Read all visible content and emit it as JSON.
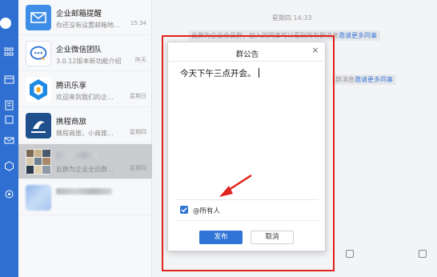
{
  "conversations": [
    {
      "name": "企业邮箱提醒",
      "preview": "你还没有设置邮箱地...",
      "time": "15:34",
      "avatar": "mail-avatar",
      "color": "#3e8ee8"
    },
    {
      "name": "企业微信团队",
      "preview": "3.0.12版本新功能介绍",
      "time": "昨天",
      "avatar": "wecom-team-avatar",
      "color": "#2f74d6"
    },
    {
      "name": "腾讯乐享",
      "preview": "欢迎来到我们的企...",
      "time": "星期日",
      "avatar": "lexiang-avatar",
      "color": "#1e88e5"
    },
    {
      "name": "携程商旅",
      "preview": "携程商旅，小商旅...",
      "time": "星期四",
      "avatar": "ctrip-avatar",
      "color": "#1f4f8c"
    },
    {
      "name": "",
      "preview": "此群为企业全员群...",
      "time": "星期四",
      "avatar": "group-avatar",
      "color": "#8a8d91"
    },
    {
      "name": "",
      "preview": "",
      "time": "",
      "avatar": "blurred-avatar",
      "color": "#9cc0ef"
    }
  ],
  "chat": {
    "timestamp": "星期四 14:33",
    "system_message_1": "此群为企业全员群，加入的同事可以看到所有群消息",
    "system_link_1": "邀请更多同事",
    "system_message_2": "群消息",
    "system_link_2": "邀请更多同事"
  },
  "dialog": {
    "title": "群公告",
    "close_glyph": "×",
    "content": "今天下午三点开会。",
    "mention_all_label": "@所有人",
    "mention_all_checked": true,
    "publish_label": "发布",
    "cancel_label": "取消"
  },
  "colors": {
    "rail": "#2e6fd1",
    "accent": "#2f74d6",
    "highlight_box": "#e0231c"
  }
}
